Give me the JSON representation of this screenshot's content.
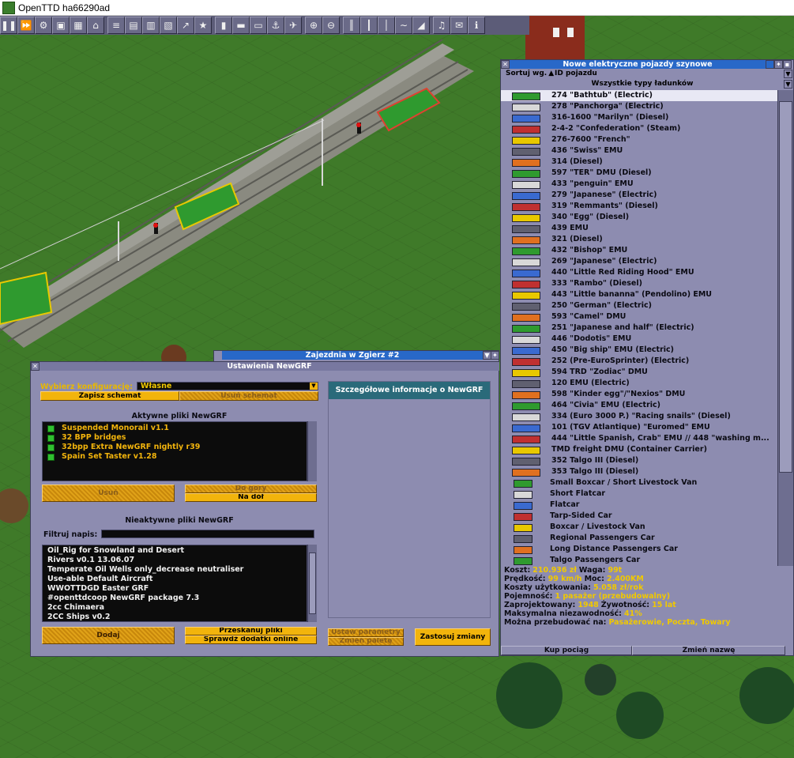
{
  "window": {
    "title": "OpenTTD ha66290ad"
  },
  "toolbar": {
    "buttons": [
      {
        "name": "pause-icon",
        "glyph": "❚❚"
      },
      {
        "name": "fast-forward-icon",
        "glyph": "⏩"
      },
      {
        "name": "gear-icon",
        "glyph": "⚙"
      },
      {
        "name": "save-icon",
        "glyph": "▣"
      },
      {
        "name": "minimap-icon",
        "glyph": "▦"
      },
      {
        "name": "town-directory-icon",
        "glyph": "⌂"
      },
      {
        "name": "subsidies-icon",
        "glyph": "≡"
      },
      {
        "name": "stations-icon",
        "glyph": "▤"
      },
      {
        "name": "finances-icon",
        "glyph": "▥"
      },
      {
        "name": "company-icon",
        "glyph": "▧"
      },
      {
        "name": "graphs-icon",
        "glyph": "↗"
      },
      {
        "name": "league-icon",
        "glyph": "★"
      },
      {
        "name": "industries-icon",
        "glyph": "▮"
      },
      {
        "name": "trains-icon",
        "glyph": "▬"
      },
      {
        "name": "road-vehicles-icon",
        "glyph": "▭"
      },
      {
        "name": "ships-icon",
        "glyph": "⚓"
      },
      {
        "name": "aircraft-icon",
        "glyph": "✈"
      },
      {
        "name": "zoom-in-icon",
        "glyph": "⊕"
      },
      {
        "name": "zoom-out-icon",
        "glyph": "⊖"
      },
      {
        "name": "build-rail-icon",
        "glyph": "║"
      },
      {
        "name": "build-road-icon",
        "glyph": "┃"
      },
      {
        "name": "build-tram-icon",
        "glyph": "│"
      },
      {
        "name": "build-water-icon",
        "glyph": "∼"
      },
      {
        "name": "landscaping-icon",
        "glyph": "◢"
      },
      {
        "name": "music-icon",
        "glyph": "♫"
      },
      {
        "name": "messages-icon",
        "glyph": "✉"
      },
      {
        "name": "info-icon",
        "glyph": "ℹ"
      }
    ]
  },
  "depot": {
    "title": "Zajezdnia w Zgierz #2"
  },
  "newgrf": {
    "title": "Ustawienia NewGRF",
    "config_label": "Wybierz konfigurację:",
    "config_value": "Własne",
    "save_preset": "Zapisz schemat",
    "delete_preset": "Usuń schemat",
    "active_title": "Aktywne pliki NewGRF",
    "active": [
      "Suspended Monorail v1.1",
      "32 BPP bridges",
      "32bpp Extra NewGRF nightly r39",
      "Spain Set Taster v1.28"
    ],
    "remove": "Usuń",
    "move_up": "Do góry",
    "move_down": "Na dół",
    "inactive_title": "Nieaktywne pliki NewGRF",
    "filter_label": "Filtruj napis:",
    "inactive": [
      "Oil_Rig for Snowland and Desert",
      "Rivers v0.1 13.06.07",
      "Temperate Oil Wells only_decrease neutraliser",
      "Use-able Default Aircraft",
      "WWOTTDGD Easter GRF",
      "#openttdcoop NewGRF package 7.3",
      "2cc Chimaera",
      "2CC Ships v0.2"
    ],
    "add": "Dodaj",
    "rescan": "Przeskanuj pliki",
    "check_online": "Sprawdź dodatki online",
    "details_title": "Szczegółowe informacje o NewGRF",
    "set_params": "Ustaw parametry",
    "change_palette": "Zmień paletę",
    "apply": "Zastosuj zmiany"
  },
  "build_window": {
    "title": "Nowe elektryczne pojazdy szynowe",
    "sort_label": "Sortuj wg.",
    "sort_value": "ID pojazdu",
    "cargo_filter": "Wszystkie typy ładunków",
    "vehicles": [
      "274 \"Bathtub\" (Electric)",
      "278 \"Panchorga\" (Electric)",
      "316-1600 \"Marilyn\" (Diesel)",
      "2-4-2 \"Confederation\" (Steam)",
      "276-7600 \"French\"",
      "436 \"Swiss\" EMU",
      "314 (Diesel)",
      "597 \"TER\" DMU (Diesel)",
      "433 \"penguin\" EMU",
      "279 \"Japanese\" (Electric)",
      "319 \"Remmants\" (Diesel)",
      "340 \"Egg\" (Diesel)",
      "439 EMU",
      "321 (Diesel)",
      "432 \"Bishop\" EMU",
      "269 \"Japanese\" (Electric)",
      "440 \"Little Red Riding Hood\" EMU",
      "333 \"Rambo\" (Diesel)",
      "443 \"Little bananna\" (Pendolino) EMU",
      "250 \"German\" (Electric)",
      "593 \"Camel\" DMU",
      "251 \"Japanese and half\" (Electric)",
      "446 \"Dodotis\" EMU",
      "450 \"Big ship\" EMU (Electric)",
      "252 (Pre-EuroSprinter) (Electric)",
      "594 TRD \"Zodiac\" DMU",
      "120 EMU (Electric)",
      "598 \"Kinder egg\"/\"Nexios\" DMU",
      "464 \"Civia\" EMU (Electric)",
      "334 (Euro 3000 P.) \"Racing snails\" (Diesel)",
      "101 (TGV Atlantique) \"Euromed\" EMU",
      "444 \"Little Spanish, Crab\" EMU // 448 \"washing m...",
      "TMD freight DMU (Container Carrier)",
      "352 Talgo III (Diesel)",
      "353 Talgo III (Diesel)",
      "Small Boxcar / Short Livestock Van",
      "Short Flatcar",
      "Flatcar",
      "Tarp-Sided Car",
      "Boxcar / Livestock Van",
      "Regional Passengers Car",
      "Long Distance Passengers Car",
      "Talgo Passengers Car"
    ],
    "info": [
      {
        "label": "Koszt:",
        "value": "210.936 zł",
        "label2": "Waga:",
        "value2": "99t"
      },
      {
        "label": "Prędkość:",
        "value": "99 km/h",
        "label2": "Moc:",
        "value2": "2.400KM"
      },
      {
        "label": "Koszty użytkowania:",
        "value": "5.058 zł/rok"
      },
      {
        "label": "Pojemność:",
        "value": "1 pasażer (przebudowalny)"
      },
      {
        "label": "Zaprojektowany:",
        "value": "1948",
        "label2": "Żywotność:",
        "value2": "15 lat"
      },
      {
        "label": "Maksymalna niezawodność:",
        "value": "41%"
      },
      {
        "label": "Można przebudować na:",
        "value": "Pasażerowie, Poczta, Towary"
      }
    ],
    "buy": "Kup pociąg",
    "rename": "Zmień nazwę"
  },
  "colors": {
    "window_bg": "#8d8cb0",
    "title_blue": "#2868c8",
    "orange": "#f2b40c",
    "value_yellow": "#f0c800"
  }
}
